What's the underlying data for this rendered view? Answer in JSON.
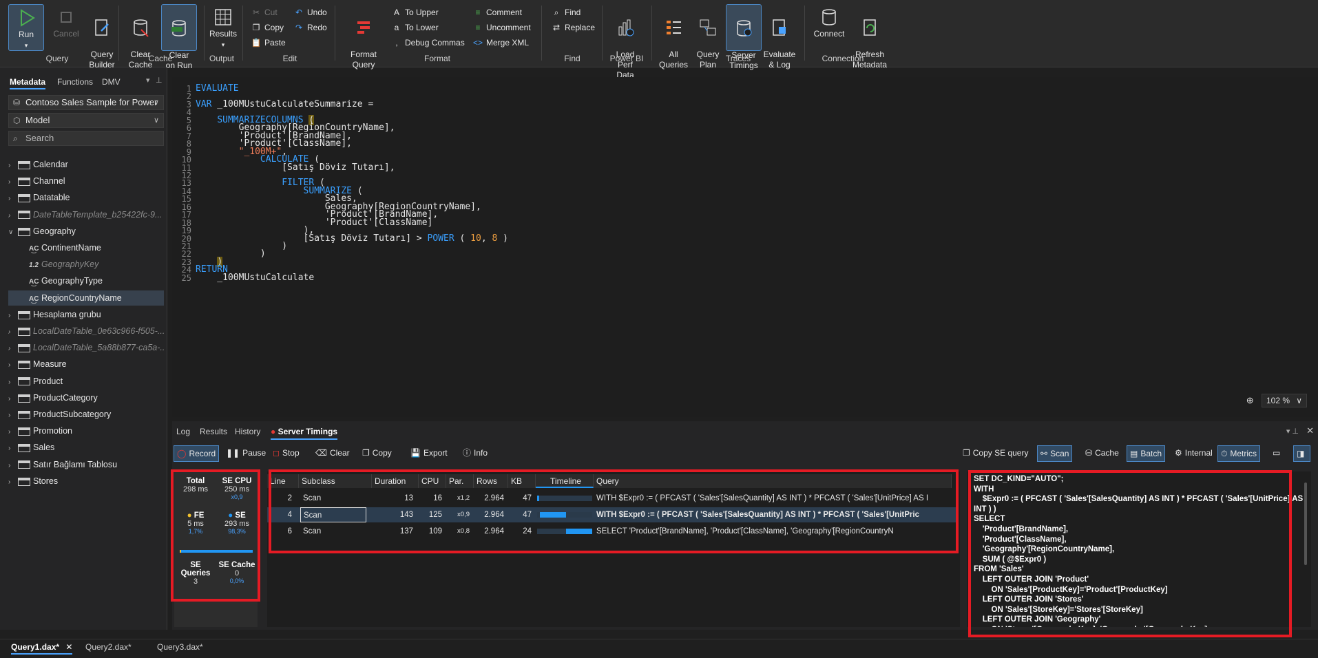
{
  "ribbon": {
    "query": {
      "label": "Query",
      "run": "Run",
      "cancel": "Cancel",
      "builder": "Query\nBuilder"
    },
    "cache": {
      "label": "Cache",
      "clear": "Clear\nCache",
      "clear_on_run": "Clear\non Run"
    },
    "output": {
      "label": "Output",
      "results": "Results"
    },
    "edit": {
      "label": "Edit",
      "cut": "Cut",
      "copy": "Copy",
      "paste": "Paste",
      "undo": "Undo",
      "redo": "Redo"
    },
    "format": {
      "label": "Format",
      "format_query": "Format\nQuery",
      "to_upper": "To Upper",
      "to_lower": "To Lower",
      "debug_commas": "Debug Commas",
      "comment": "Comment",
      "uncomment": "Uncomment",
      "merge_xml": "Merge XML"
    },
    "find": {
      "label": "Find",
      "find": "Find",
      "replace": "Replace"
    },
    "powerbi": {
      "label": "Power BI",
      "load_perf": "Load Perf\nData"
    },
    "traces": {
      "label": "Traces",
      "all_queries": "All\nQueries",
      "query_plan": "Query\nPlan",
      "server_timings": "Server\nTimings",
      "evaluate_log": "Evaluate\n& Log"
    },
    "connection": {
      "label": "Connection",
      "connect": "Connect",
      "refresh": "Refresh\nMetadata"
    }
  },
  "left": {
    "tabs": [
      "Metadata",
      "Functions",
      "DMV"
    ],
    "database": "Contoso Sales Sample for Power",
    "model": "Model",
    "search_placeholder": "Search",
    "tree": [
      {
        "label": "Calendar",
        "kind": "table"
      },
      {
        "label": "Channel",
        "kind": "table"
      },
      {
        "label": "Datatable",
        "kind": "table"
      },
      {
        "label": "DateTableTemplate_b25422fc-9...",
        "kind": "table-hidden"
      },
      {
        "label": "Geography",
        "kind": "table-open"
      },
      {
        "label": "ContinentName",
        "kind": "col-text"
      },
      {
        "label": "GeographyKey",
        "kind": "col-num-hidden"
      },
      {
        "label": "GeographyType",
        "kind": "col-text"
      },
      {
        "label": "RegionCountryName",
        "kind": "col-text-sel"
      },
      {
        "label": "Hesaplama grubu",
        "kind": "table"
      },
      {
        "label": "LocalDateTable_0e63c966-f505-...",
        "kind": "table-hidden"
      },
      {
        "label": "LocalDateTable_5a88b877-ca5a-...",
        "kind": "table-hidden"
      },
      {
        "label": "Measure",
        "kind": "table"
      },
      {
        "label": "Product",
        "kind": "table"
      },
      {
        "label": "ProductCategory",
        "kind": "table"
      },
      {
        "label": "ProductSubcategory",
        "kind": "table"
      },
      {
        "label": "Promotion",
        "kind": "table"
      },
      {
        "label": "Sales",
        "kind": "table"
      },
      {
        "label": "Satır Bağlamı Tablosu",
        "kind": "table"
      },
      {
        "label": "Stores",
        "kind": "table"
      }
    ]
  },
  "editor": {
    "zoom": "102 %",
    "line_numbers": [
      "1",
      "2",
      "3",
      "4",
      "5",
      "6",
      "7",
      "8",
      "9",
      "10",
      "11",
      "12",
      "13",
      "14",
      "15",
      "16",
      "17",
      "18",
      "19",
      "20",
      "21",
      "22",
      "23",
      "24",
      "25"
    ],
    "lines": [
      "EVALUATE",
      "",
      "VAR _100MUstuCalculateSummarize =",
      "",
      "    SUMMARIZECOLUMNS (",
      "        Geography[RegionCountryName],",
      "        'Product'[BrandName],",
      "        'Product'[ClassName],",
      "        \"_100M+\",",
      "            CALCULATE (",
      "                [Satış Döviz Tutarı],",
      "",
      "                FILTER (",
      "                    SUMMARIZE (",
      "                        Sales,",
      "                        Geography[RegionCountryName],",
      "                        'Product'[BrandName],",
      "                        'Product'[ClassName]",
      "                    ),",
      "                    [Satış Döviz Tutarı] > POWER ( 10, 8 )",
      "                )",
      "            )",
      "    )",
      "RETURN",
      "    _100MUstuCalculate"
    ]
  },
  "bottom": {
    "tabs": [
      "Log",
      "Results",
      "History",
      "Server Timings"
    ],
    "toolbar": {
      "record": "Record",
      "pause": "Pause",
      "stop": "Stop",
      "clear": "Clear",
      "copy": "Copy",
      "export": "Export",
      "info": "Info",
      "copy_se": "Copy SE query",
      "scan": "Scan",
      "cache": "Cache",
      "batch": "Batch",
      "internal": "Internal",
      "metrics": "Metrics"
    },
    "summary": {
      "total_label": "Total",
      "total": "298 ms",
      "secpu_label": "SE CPU",
      "secpu": "250 ms",
      "secpu_x": "x0,9",
      "fe_label": "FE",
      "fe": "5 ms",
      "fe_pct": "1,7%",
      "se_label": "SE",
      "se": "293 ms",
      "se_pct": "98,3%",
      "se_fraction": 0.983,
      "seq_label": "SE Queries",
      "seq": "3",
      "sec_label": "SE Cache",
      "sec": "0",
      "sec_pct": "0,0%"
    },
    "grid": {
      "headers": [
        "Line",
        "Subclass",
        "Duration",
        "CPU",
        "Par.",
        "Rows",
        "KB",
        "Timeline",
        "Query"
      ],
      "rows": [
        {
          "line": "2",
          "subclass": "Scan",
          "duration": "13",
          "cpu": "16",
          "par": "x1,2",
          "rows": "2.964",
          "kb": "47",
          "tl_start": 0.0,
          "tl_len": 0.04,
          "query": "WITH $Expr0 := ( PFCAST ( 'Sales'[SalesQuantity] AS INT ) * PFCAST ( 'Sales'[UnitPrice] AS I"
        },
        {
          "line": "4",
          "subclass": "Scan",
          "duration": "143",
          "cpu": "125",
          "par": "x0,9",
          "rows": "2.964",
          "kb": "47",
          "tl_start": 0.05,
          "tl_len": 0.48,
          "query": "WITH $Expr0 := ( PFCAST ( 'Sales'[SalesQuantity] AS INT ) * PFCAST ( 'Sales'[UnitPric"
        },
        {
          "line": "6",
          "subclass": "Scan",
          "duration": "137",
          "cpu": "109",
          "par": "x0,8",
          "rows": "2.964",
          "kb": "24",
          "tl_start": 0.53,
          "tl_len": 0.47,
          "query": "SELECT 'Product'[BrandName], 'Product'[ClassName], 'Geography'[RegionCountryN"
        }
      ]
    },
    "query_text": [
      "SET DC_KIND=\"AUTO\";",
      "WITH",
      "    $Expr0 := ( PFCAST ( 'Sales'[SalesQuantity] AS INT ) * PFCAST ( 'Sales'[UnitPrice] AS",
      "INT ) )",
      "SELECT",
      "    'Product'[BrandName],",
      "    'Product'[ClassName],",
      "    'Geography'[RegionCountryName],",
      "    SUM ( @$Expr0 )",
      "FROM 'Sales'",
      "    LEFT OUTER JOIN 'Product'",
      "        ON 'Sales'[ProductKey]='Product'[ProductKey]",
      "    LEFT OUTER JOIN 'Stores'",
      "        ON 'Sales'[StoreKey]='Stores'[StoreKey]",
      "    LEFT OUTER JOIN 'Geography'",
      "        ON 'Stores'[GeographyKey]='Geography'[GeographyKey]"
    ]
  },
  "doctabs": [
    "Query1.dax*",
    "Query2.dax*",
    "Query3.dax*"
  ],
  "colors": {
    "accent": "#4aa3ff",
    "highlight": "#e51b24",
    "timeline": "#2196f3",
    "fe_dot": "#f2c12e"
  }
}
